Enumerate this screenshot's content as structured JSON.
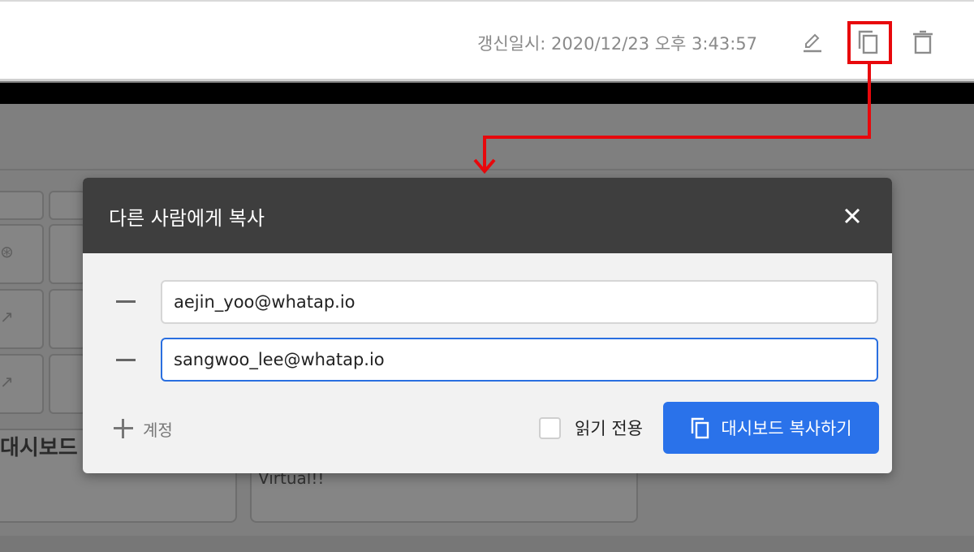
{
  "toolbar": {
    "updated_at": "갱신일시: 2020/12/23 오후 3:43:57",
    "icons": {
      "edit": "pencil-icon",
      "copy": "copy-icon",
      "delete": "trash-icon"
    }
  },
  "background": {
    "dashboard_label": "대시보드",
    "card_text": "Virtual!!"
  },
  "modal": {
    "title": "다른 사람에게 복사",
    "recipients": [
      {
        "email": "aejin_yoo@whatap.io"
      },
      {
        "email": "sangwoo_lee@whatap.io"
      }
    ],
    "add_account_label": "계정",
    "readonly_label": "읽기 전용",
    "readonly_checked": false,
    "submit_label": "대시보드 복사하기"
  },
  "colors": {
    "highlight": "#e8080c",
    "primary": "#2a72ea",
    "modal_header": "#3e3e3e"
  }
}
